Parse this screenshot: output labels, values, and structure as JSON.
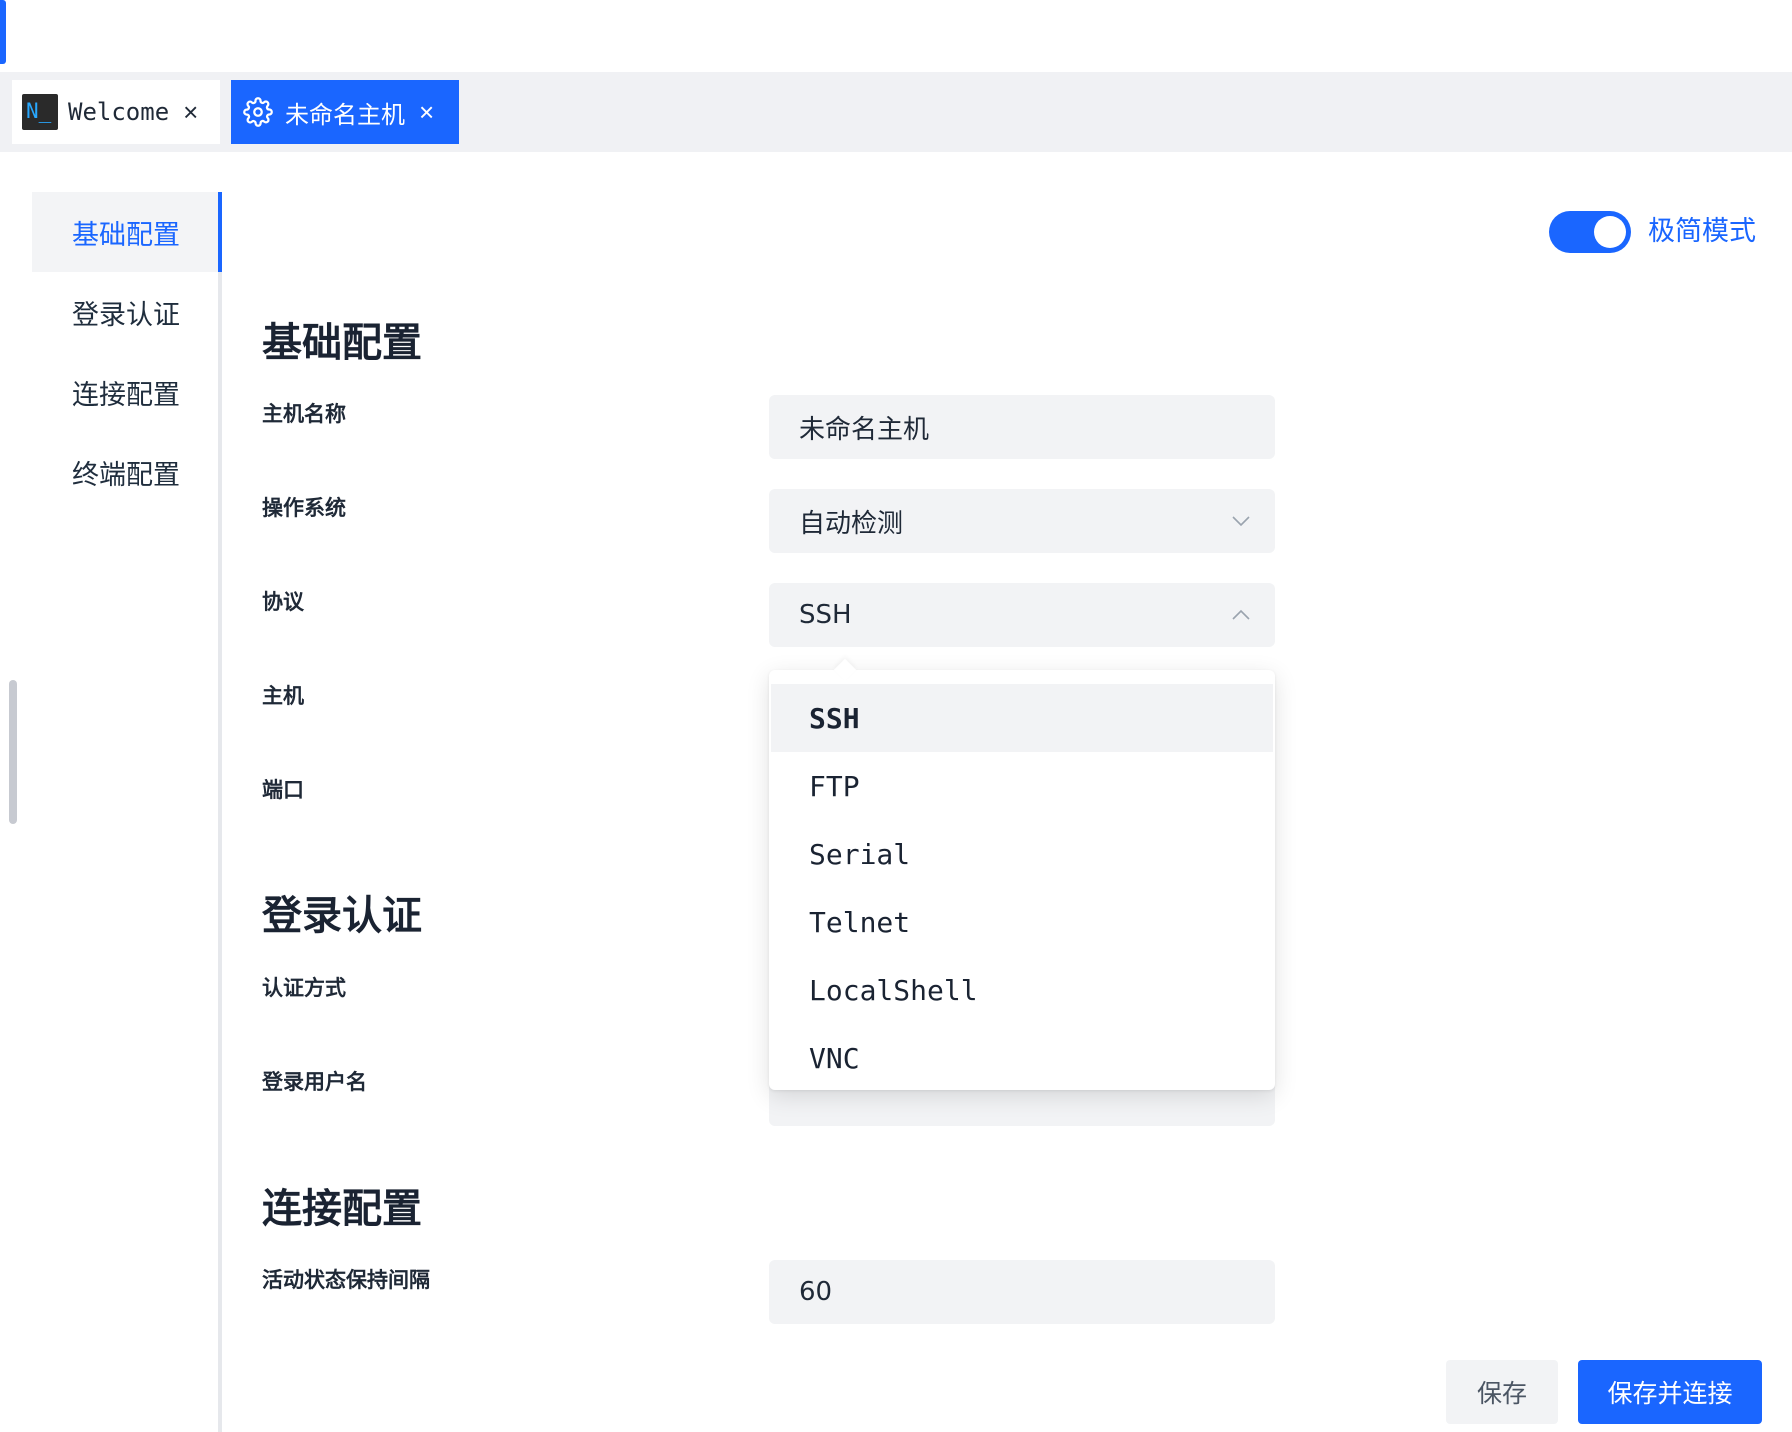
{
  "tabs": [
    {
      "icon": "terminal-app-icon",
      "icon_text": "N_",
      "label": "Welcome",
      "active": false
    },
    {
      "icon": "gear-icon",
      "label": "未命名主机",
      "active": true
    }
  ],
  "sidebar": {
    "items": [
      {
        "label": "基础配置",
        "active": true
      },
      {
        "label": "登录认证",
        "active": false
      },
      {
        "label": "连接配置",
        "active": false
      },
      {
        "label": "终端配置",
        "active": false
      }
    ]
  },
  "mode_toggle": {
    "label": "极简模式",
    "on": true
  },
  "sections": {
    "basic": {
      "title": "基础配置",
      "host_name": {
        "label": "主机名称",
        "value": "未命名主机"
      },
      "os": {
        "label": "操作系统",
        "value": "自动检测"
      },
      "protocol": {
        "label": "协议",
        "value": "SSH"
      },
      "host": {
        "label": "主机"
      },
      "port": {
        "label": "端口"
      }
    },
    "auth": {
      "title": "登录认证",
      "method": {
        "label": "认证方式"
      },
      "username": {
        "label": "登录用户名"
      }
    },
    "connection": {
      "title": "连接配置",
      "keepalive": {
        "label": "活动状态保持间隔",
        "value": "60"
      }
    }
  },
  "protocol_dropdown": {
    "options": [
      "SSH",
      "FTP",
      "Serial",
      "Telnet",
      "LocalShell",
      "VNC"
    ],
    "selected": "SSH"
  },
  "footer": {
    "save_label": "保存",
    "save_connect_label": "保存并连接"
  },
  "colors": {
    "accent": "#1a66ff",
    "field_bg": "#f2f3f5",
    "tabbar_bg": "#f0f1f4"
  }
}
